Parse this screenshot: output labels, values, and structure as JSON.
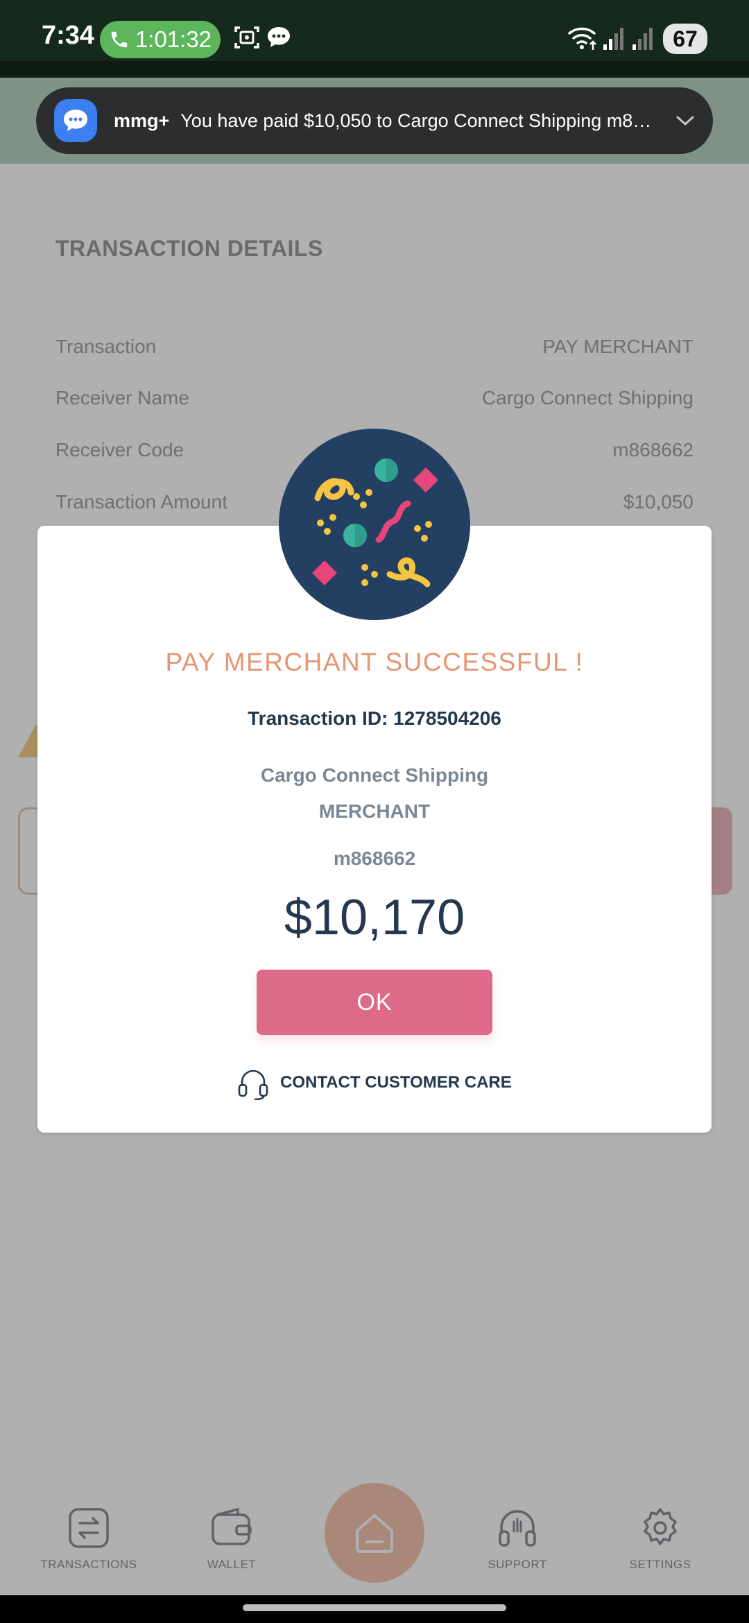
{
  "status_bar": {
    "time": "7:34",
    "call_timer": "1:01:32",
    "battery": "67"
  },
  "background_screen": {
    "section_title": "TRANSACTION DETAILS",
    "rows": [
      {
        "label": "Transaction",
        "value": "PAY MERCHANT"
      },
      {
        "label": "Receiver Name",
        "value": "Cargo Connect Shipping"
      },
      {
        "label": "Receiver Code",
        "value": "m868662"
      },
      {
        "label": "Transaction Amount",
        "value": "$10,050"
      }
    ]
  },
  "notification": {
    "app_name": "mmg+",
    "text": "You have paid $10,050 to Cargo Connect Shipping m868662..."
  },
  "dialog": {
    "title": "PAY MERCHANT SUCCESSFUL !",
    "transaction_id": "Transaction ID: 1278504206",
    "receiver_name": "Cargo Connect Shipping",
    "receiver_type": "MERCHANT",
    "receiver_code": "m868662",
    "amount": "$10,170",
    "ok_label": "OK",
    "care_label": "CONTACT CUSTOMER CARE"
  },
  "bottom_nav": {
    "items": [
      {
        "label": "TRANSACTIONS",
        "icon": "transactions-icon"
      },
      {
        "label": "WALLET",
        "icon": "wallet-icon"
      },
      {
        "label": "",
        "icon": "home-icon"
      },
      {
        "label": "SUPPORT",
        "icon": "headset-icon"
      },
      {
        "label": "SETTINGS",
        "icon": "gear-icon"
      }
    ]
  },
  "colors": {
    "status_bar": "#15291c",
    "call_pill": "#5eb65c",
    "dialog_title": "#e59572",
    "ok_button": "#de6a89",
    "dark_navy": "#23384f"
  }
}
